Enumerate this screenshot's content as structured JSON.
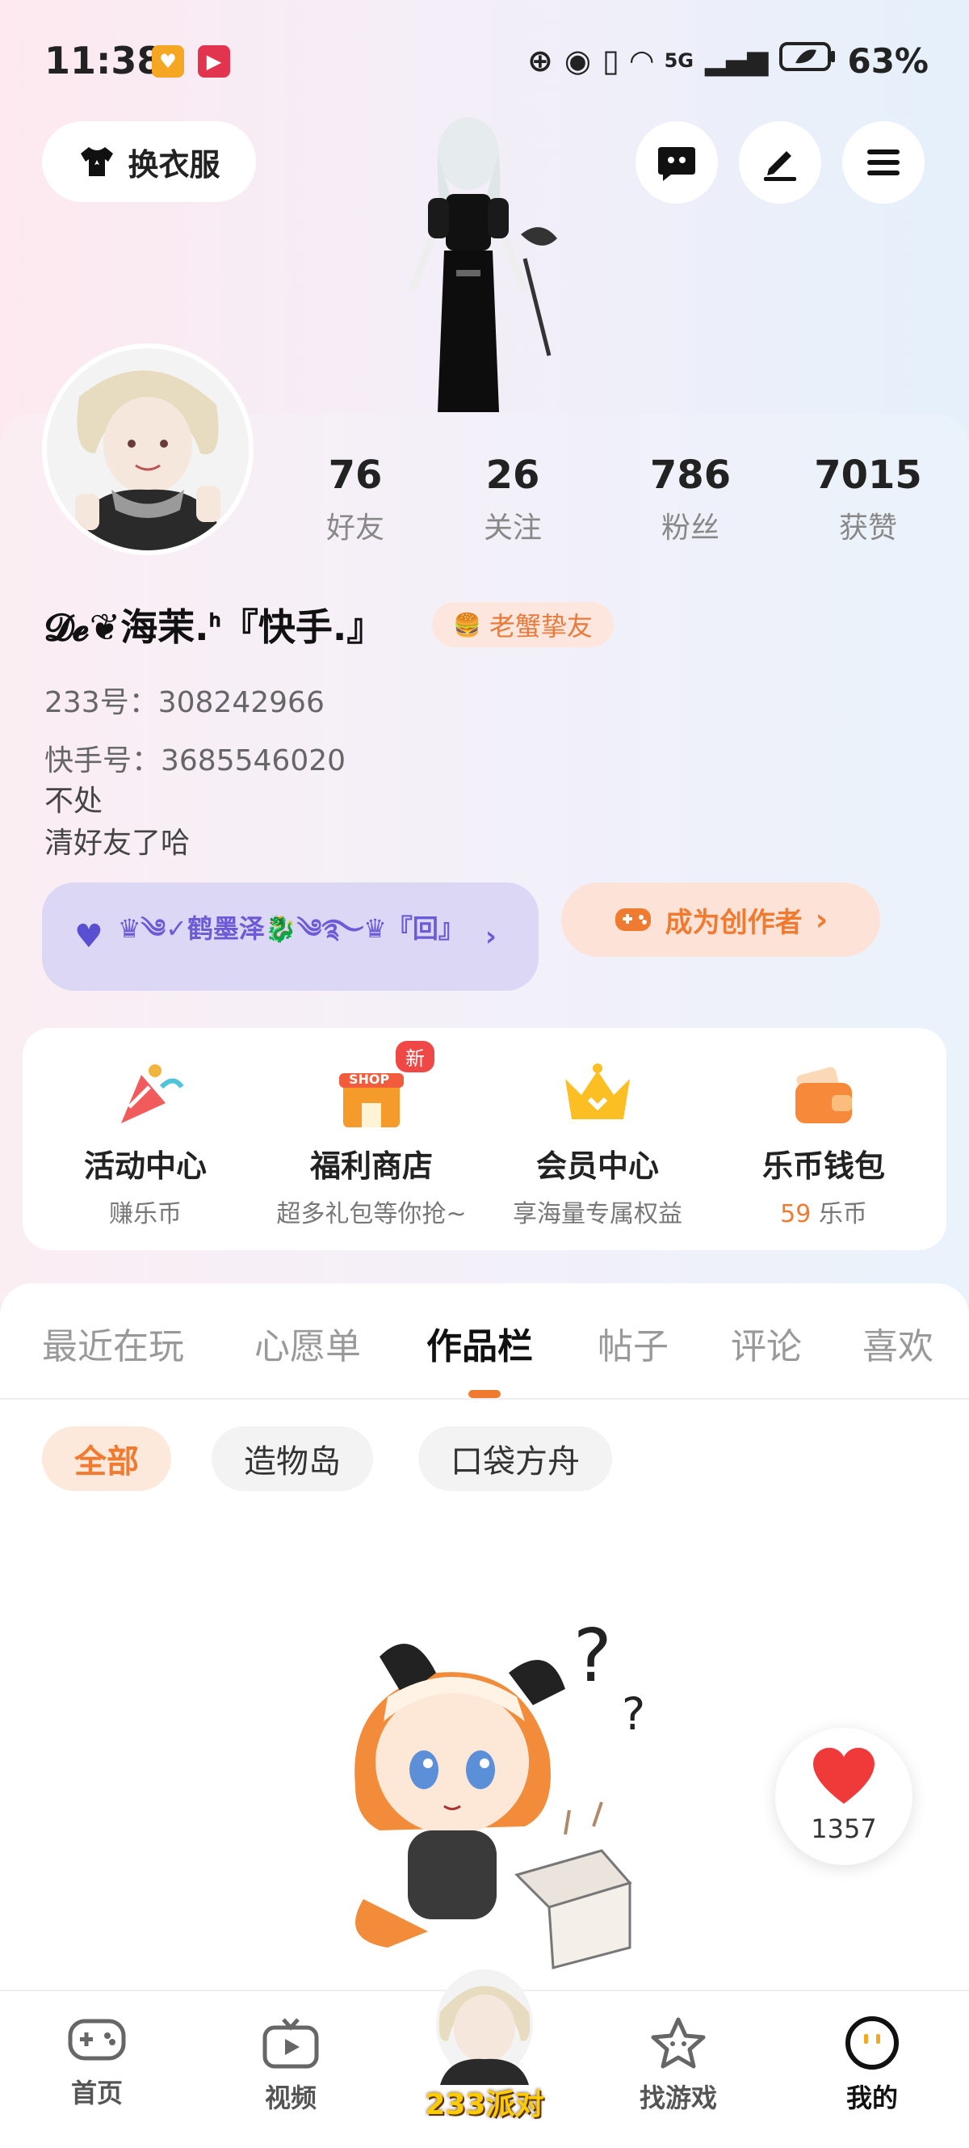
{
  "status_bar": {
    "time": "11:38",
    "network": "5G",
    "battery": "63%"
  },
  "top_bar": {
    "dress_label": "换衣服"
  },
  "profile": {
    "stats": [
      {
        "num": "76",
        "label": "好友"
      },
      {
        "num": "26",
        "label": "关注"
      },
      {
        "num": "786",
        "label": "粉丝"
      },
      {
        "num": "7015",
        "label": "获赞"
      }
    ],
    "username": "𝓓𝓮❦海茉.ᑋ『快手.』",
    "badge": "老蟹挚友",
    "id_233": "233号：308242966",
    "kuaishou_id": "快手号：3685546020",
    "bio_lines": [
      "不处",
      "清好友了哈"
    ],
    "guild": "♛༄✓鹤墨泽🐉༄࿐♛『回』",
    "creator_label": "成为创作者"
  },
  "menu": [
    {
      "title": "活动中心",
      "sub": "赚乐币"
    },
    {
      "title": "福利商店",
      "sub": "超多礼包等你抢~",
      "tag": "新",
      "icon_text": "SHOP"
    },
    {
      "title": "会员中心",
      "sub": "享海量专属权益"
    },
    {
      "title": "乐币钱包",
      "sub_num": "59",
      "sub_unit": " 乐币"
    }
  ],
  "tabs": [
    "最近在玩",
    "心愿单",
    "作品栏",
    "帖子",
    "评论",
    "喜欢"
  ],
  "active_tab": "作品栏",
  "chips": [
    "全部",
    "造物岛",
    "口袋方舟"
  ],
  "likes": "1357",
  "bottom_nav": {
    "home": "首页",
    "video": "视频",
    "party": "233派对",
    "games": "找游戏",
    "me": "我的"
  },
  "colors": {
    "accent": "#f07b30",
    "guild_purple": "#6b5bd6"
  }
}
